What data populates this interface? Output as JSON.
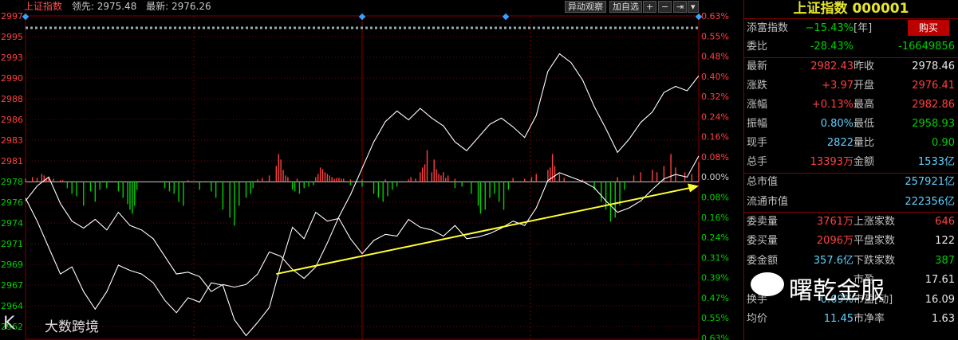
{
  "header": {
    "title": "上证指数",
    "lead_label": "领先: 2975.48",
    "latest_label": "最新: 2976.26"
  },
  "toolbar": {
    "watch": "异动观察",
    "add_fav": "加自选",
    "plus": "+",
    "minus": "−",
    "last": "⇥",
    "menu": "▾"
  },
  "watermarks": {
    "left": "大数跨境",
    "right": "曙乾金服"
  },
  "colors": {
    "up": "#ff4040",
    "down": "#00d000",
    "grid": "#800000",
    "price_line": "#ffffff",
    "arrow": "#ffff33",
    "marker": "#3aa0ff"
  },
  "chart_data": {
    "type": "line",
    "y_left_ticks": [
      "2997",
      "2995",
      "2993",
      "2990",
      "2988",
      "2986",
      "2983",
      "2981",
      "2978",
      "2976",
      "2974",
      "2971",
      "2969",
      "2967",
      "2964",
      "2962"
    ],
    "y_right_ticks": [
      "0.63%",
      "0.55%",
      "0.48%",
      "0.40%",
      "0.32%",
      "0.24%",
      "0.16%",
      "0.08%",
      "0.00%",
      "0.08%",
      "0.16%",
      "0.24%",
      "0.31%",
      "0.39%",
      "0.47%",
      "0.55%",
      "0.63%"
    ],
    "prev_close": 2978.46,
    "ylim": [
      2960.5,
      2997.3
    ],
    "x_points": 241,
    "series": [
      {
        "values": [
          [
            0,
            2976.3
          ],
          [
            5,
            2978.0
          ],
          [
            10,
            2979.0
          ],
          [
            15,
            2976.0
          ],
          [
            20,
            2974.0
          ],
          [
            25,
            2973.2
          ],
          [
            30,
            2974.2
          ],
          [
            35,
            2973.0
          ],
          [
            40,
            2975.0
          ],
          [
            45,
            2973.5
          ],
          [
            50,
            2973.0
          ],
          [
            55,
            2972.0
          ],
          [
            60,
            2970.0
          ],
          [
            65,
            2968.0
          ],
          [
            70,
            2968.2
          ],
          [
            75,
            2967.7
          ],
          [
            80,
            2966.0
          ],
          [
            85,
            2966.8
          ],
          [
            90,
            2966.5
          ],
          [
            95,
            2966.8
          ],
          [
            100,
            2968.0
          ],
          [
            105,
            2970.5
          ],
          [
            110,
            2970.0
          ],
          [
            115,
            2968.5
          ],
          [
            120,
            2967.5
          ],
          [
            125,
            2968.8
          ],
          [
            130,
            2971.5
          ],
          [
            135,
            2974.5
          ],
          [
            140,
            2977.0
          ],
          [
            145,
            2980.0
          ],
          [
            150,
            2983.0
          ],
          [
            155,
            2985.3
          ],
          [
            160,
            2986.5
          ],
          [
            165,
            2985.5
          ],
          [
            170,
            2986.8
          ],
          [
            175,
            2985.7
          ],
          [
            180,
            2984.8
          ],
          [
            185,
            2983.0
          ],
          [
            190,
            2982.0
          ],
          [
            195,
            2983.5
          ],
          [
            200,
            2985.0
          ],
          [
            205,
            2985.7
          ],
          [
            210,
            2984.7
          ],
          [
            215,
            2983.5
          ],
          [
            220,
            2986.0
          ],
          [
            225,
            2991.0
          ],
          [
            230,
            2993.0
          ],
          [
            235,
            2992.0
          ],
          [
            240,
            2990.0
          ],
          [
            245,
            2987.0
          ],
          [
            250,
            2984.5
          ],
          [
            255,
            2981.8
          ],
          [
            260,
            2983.3
          ],
          [
            265,
            2985.2
          ],
          [
            270,
            2986.4
          ],
          [
            275,
            2988.6
          ],
          [
            280,
            2989.3
          ],
          [
            285,
            2988.8
          ],
          [
            290,
            2990.5
          ]
        ]
      },
      {
        "values": [
          [
            0,
            2976.6
          ],
          [
            5,
            2974.0
          ],
          [
            10,
            2971.0
          ],
          [
            15,
            2968.0
          ],
          [
            20,
            2968.8
          ],
          [
            25,
            2966.0
          ],
          [
            30,
            2964.0
          ],
          [
            35,
            2966.0
          ],
          [
            40,
            2969.0
          ],
          [
            45,
            2968.4
          ],
          [
            50,
            2968.0
          ],
          [
            55,
            2967.0
          ],
          [
            60,
            2965.0
          ],
          [
            65,
            2963.6
          ],
          [
            70,
            2965.3
          ],
          [
            75,
            2964.8
          ],
          [
            80,
            2967.0
          ],
          [
            85,
            2966.7
          ],
          [
            90,
            2962.8
          ],
          [
            95,
            2961.0
          ],
          [
            100,
            2962.5
          ],
          [
            105,
            2964.2
          ],
          [
            110,
            2969.0
          ],
          [
            115,
            2973.3
          ],
          [
            120,
            2972.0
          ],
          [
            125,
            2975.0
          ],
          [
            130,
            2974.0
          ],
          [
            135,
            2974.3
          ],
          [
            140,
            2972.0
          ],
          [
            145,
            2970.3
          ],
          [
            150,
            2971.8
          ],
          [
            155,
            2972.5
          ],
          [
            160,
            2972.3
          ],
          [
            165,
            2974.2
          ],
          [
            170,
            2973.3
          ],
          [
            175,
            2973.0
          ],
          [
            180,
            2972.3
          ],
          [
            185,
            2973.5
          ],
          [
            190,
            2972.0
          ],
          [
            195,
            2972.2
          ],
          [
            200,
            2972.6
          ],
          [
            205,
            2973.2
          ],
          [
            210,
            2974.0
          ],
          [
            215,
            2973.5
          ],
          [
            220,
            2975.5
          ],
          [
            225,
            2978.6
          ],
          [
            230,
            2979.5
          ],
          [
            235,
            2979.0
          ],
          [
            240,
            2978.5
          ],
          [
            245,
            2977.8
          ],
          [
            250,
            2976.3
          ],
          [
            255,
            2975.0
          ],
          [
            260,
            2975.5
          ],
          [
            265,
            2976.3
          ],
          [
            270,
            2977.6
          ],
          [
            275,
            2978.8
          ],
          [
            280,
            2979.3
          ],
          [
            285,
            2979.0
          ],
          [
            290,
            2981.4
          ]
        ]
      }
    ],
    "volume_up_x": [
      0,
      3,
      5,
      7,
      8,
      9,
      10,
      12,
      15,
      16,
      70,
      100,
      102,
      105,
      108,
      109,
      110,
      111,
      112,
      113,
      117,
      125,
      126,
      127,
      128,
      129,
      130,
      131,
      132,
      133,
      134,
      135,
      136,
      137,
      140,
      145,
      155,
      165,
      166,
      168,
      170,
      171,
      172,
      173,
      175,
      176,
      177,
      178,
      179,
      180,
      181,
      182,
      185,
      210,
      215,
      218,
      220,
      225,
      226,
      227,
      228,
      230,
      232,
      240,
      255,
      262,
      265,
      270,
      272,
      275,
      278,
      280,
      284,
      287,
      290
    ],
    "volume_up_h": [
      4,
      6,
      5,
      10,
      8,
      3,
      6,
      4,
      2,
      2,
      2,
      3,
      5,
      8,
      20,
      35,
      28,
      15,
      8,
      6,
      4,
      6,
      10,
      18,
      16,
      12,
      10,
      8,
      6,
      4,
      5,
      5,
      4,
      4,
      3,
      3,
      3,
      3,
      6,
      4,
      12,
      18,
      22,
      40,
      12,
      28,
      16,
      10,
      8,
      12,
      5,
      8,
      4,
      5,
      4,
      6,
      10,
      15,
      18,
      35,
      20,
      10,
      5,
      3,
      6,
      8,
      12,
      15,
      12,
      20,
      35,
      18,
      12,
      10,
      25
    ],
    "volume_down_x": [
      18,
      20,
      22,
      25,
      28,
      30,
      32,
      35,
      40,
      42,
      44,
      45,
      46,
      47,
      48,
      60,
      62,
      64,
      66,
      68,
      75,
      80,
      82,
      85,
      88,
      90,
      92,
      95,
      97,
      98,
      115,
      116,
      118,
      120,
      122,
      124,
      140,
      145,
      150,
      152,
      154,
      156,
      158,
      160,
      185,
      188,
      192,
      195,
      196,
      198,
      200,
      202,
      204,
      206,
      208,
      245,
      248,
      250,
      252,
      254,
      256,
      258
    ],
    "volume_down_h": [
      8,
      15,
      18,
      30,
      12,
      25,
      10,
      8,
      12,
      20,
      28,
      35,
      40,
      30,
      10,
      8,
      12,
      15,
      25,
      30,
      10,
      12,
      20,
      35,
      45,
      55,
      30,
      20,
      15,
      8,
      10,
      12,
      15,
      8,
      6,
      4,
      4,
      6,
      15,
      20,
      25,
      18,
      10,
      6,
      8,
      6,
      15,
      30,
      40,
      35,
      20,
      15,
      25,
      35,
      10,
      10,
      25,
      35,
      50,
      45,
      30,
      10
    ],
    "annotation_arrow": {
      "from": [
        108,
        2968.0
      ],
      "to": [
        290,
        2978.0
      ]
    }
  },
  "panel": {
    "title": "上证指数 000001",
    "rows": [
      {
        "l1": "添富指数",
        "v1": "−15.43%",
        "u1": "[年]",
        "btn": "购买"
      },
      {
        "l1": "委比",
        "v1": "-28.43%",
        "v2": "-16649856"
      },
      {
        "l1": "最新",
        "v1": "2982.43",
        "l2": "昨收",
        "v2": "2978.46"
      },
      {
        "l1": "涨跌",
        "v1": "+3.97",
        "l2": "开盘",
        "v2": "2976.41"
      },
      {
        "l1": "涨幅",
        "v1": "+0.13%",
        "l2": "最高",
        "v2": "2982.86"
      },
      {
        "l1": "振幅",
        "v1": "0.80%",
        "l2": "最低",
        "v2": "2958.93"
      },
      {
        "l1": "现手",
        "v1": "2822",
        "l2": "量比",
        "v2": "0.90"
      },
      {
        "l1": "总手",
        "v1": "13393万",
        "l2": "金额",
        "v2": "1533亿"
      },
      {
        "l1": "总市值",
        "v2": "257921亿"
      },
      {
        "l1": "流通市值",
        "v2": "222356亿"
      },
      {
        "l1": "委卖量",
        "v1": "3761万",
        "l2": "上涨家数",
        "v2": "646"
      },
      {
        "l1": "委买量",
        "v1": "2096万",
        "l2": "平盘家数",
        "v2": "122"
      },
      {
        "l1": "委金额",
        "v1": "357.6亿",
        "l2": "下跌家数",
        "v2": "387"
      },
      {
        "l1": "",
        "v1": "",
        "l2": "市盈",
        "v2": "17.61"
      },
      {
        "l1": "换手",
        "v1": "0.69%",
        "l2": "市盈[动]",
        "v2": "16.09"
      },
      {
        "l1": "均价",
        "v1": "11.45",
        "l2": "市净率",
        "v2": "1.63"
      }
    ]
  }
}
